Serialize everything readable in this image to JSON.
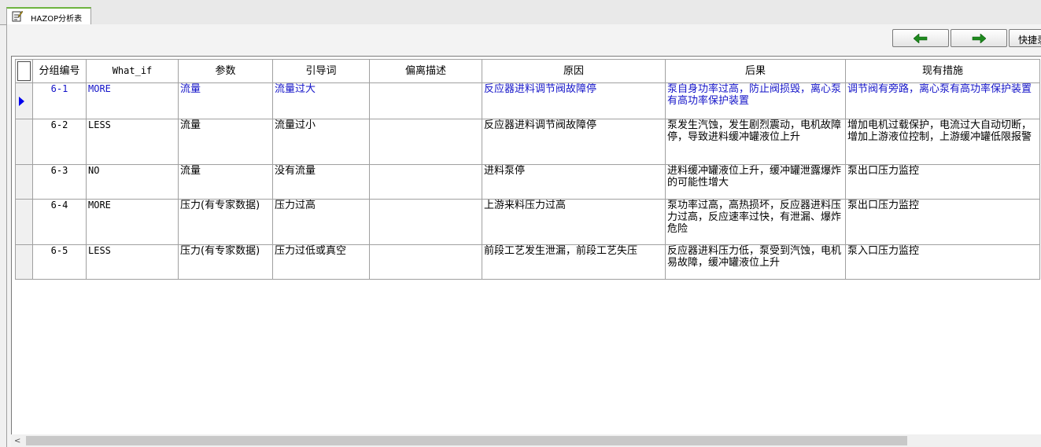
{
  "tab": {
    "label": "HAZOP分析表",
    "icon": "document-edit-icon"
  },
  "toolbar": {
    "prev_icon": "green-left-arrow-icon",
    "next_icon": "green-right-arrow-icon",
    "quick_label": "快捷录"
  },
  "table": {
    "headers": [
      "分组编号",
      "What_if",
      "参数",
      "引导词",
      "偏离描述",
      "原因",
      "后果",
      "现有措施"
    ],
    "rows": [
      {
        "id": "6-1",
        "what_if": "MORE",
        "param": "流量",
        "guide": "流量过大",
        "deviation": "",
        "cause": "反应器进料调节阀故障停",
        "consequence": "泵自身功率过高，防止阀损毁，离心泵有高功率保护装置",
        "measure": "调节阀有旁路，离心泵有高功率保护装置"
      },
      {
        "id": "6-2",
        "what_if": "LESS",
        "param": "流量",
        "guide": "流量过小",
        "deviation": "",
        "cause": "反应器进料调节阀故障停",
        "consequence": "泵发生汽蚀，发生剧烈震动，电机故障停，导致进料缓冲罐液位上升",
        "measure": "增加电机过载保护，电流过大自动切断，增加上游液位控制，上游缓冲罐低限报警"
      },
      {
        "id": "6-3",
        "what_if": "NO",
        "param": "流量",
        "guide": "没有流量",
        "deviation": "",
        "cause": "进料泵停",
        "consequence": "进料缓冲罐液位上升，缓冲罐泄露爆炸的可能性增大",
        "measure": "泵出口压力监控"
      },
      {
        "id": "6-4",
        "what_if": "MORE",
        "param": "压力(有专家数据)",
        "guide": "压力过高",
        "deviation": "",
        "cause": "上游来料压力过高",
        "consequence": "泵功率过高，高热损坏，反应器进料压力过高，反应速率过快，有泄漏、爆炸危险",
        "measure": "泵出口压力监控"
      },
      {
        "id": "6-5",
        "what_if": "LESS",
        "param": "压力(有专家数据)",
        "guide": "压力过低或真空",
        "deviation": "",
        "cause": "前段工艺发生泄漏，前段工艺失压",
        "consequence": "反应器进料压力低，泵受到汽蚀，电机易故障，缓冲罐液位上升",
        "measure": "泵入口压力监控"
      }
    ]
  },
  "colors": {
    "active_row_text": "#1414c8",
    "selector_marker": "#0000ee",
    "tab_accent": "#6db33f"
  }
}
